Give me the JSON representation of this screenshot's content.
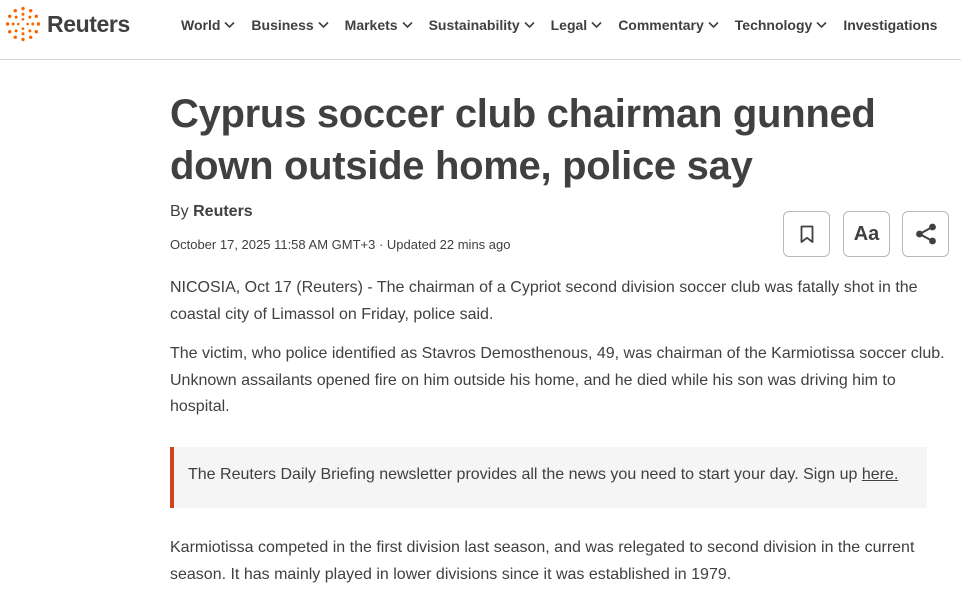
{
  "site": {
    "logo_text": "Reuters",
    "logo_icon": "reuters-dot-ring-icon",
    "brand_color": "#fa6400"
  },
  "nav": {
    "items": [
      {
        "label": "World",
        "has_dropdown": true
      },
      {
        "label": "Business",
        "has_dropdown": true
      },
      {
        "label": "Markets",
        "has_dropdown": true
      },
      {
        "label": "Sustainability",
        "has_dropdown": true
      },
      {
        "label": "Legal",
        "has_dropdown": true
      },
      {
        "label": "Commentary",
        "has_dropdown": true
      },
      {
        "label": "Technology",
        "has_dropdown": true
      },
      {
        "label": "Investigations",
        "has_dropdown": false
      }
    ]
  },
  "article": {
    "headline_line1": "Cyprus soccer club chairman gunned",
    "headline_line2": "down outside home, police say",
    "byline_prefix": "By",
    "author": "Reuters",
    "dateline": "October 17, 2025 11:58 AM GMT+3 · Updated 22 mins ago",
    "paragraphs": [
      "NICOSIA, Oct 17 (Reuters) - The chairman of a Cypriot second division soccer club was fatally shot in the coastal city of Limassol on Friday, police said.",
      "The victim, who police identified as Stavros Demosthenous, 49, was chairman of the Karmiotissa soccer club. Unknown assailants opened fire on him outside his home, and he died while his son was driving him to hospital.",
      "Karmiotissa competed in the first division last season, and was relegated to second division in the current season. It has mainly played in lower divisions since it was established in 1979."
    ],
    "promo": {
      "text": "The Reuters Daily Briefing newsletter provides all the news you need to start your day. Sign up ",
      "link_text": "here.",
      "accent_color": "#d2441c"
    }
  },
  "toolbar": {
    "bookmark_icon": "bookmark-icon",
    "text_size_label": "Aa",
    "share_icon": "share-icon"
  }
}
